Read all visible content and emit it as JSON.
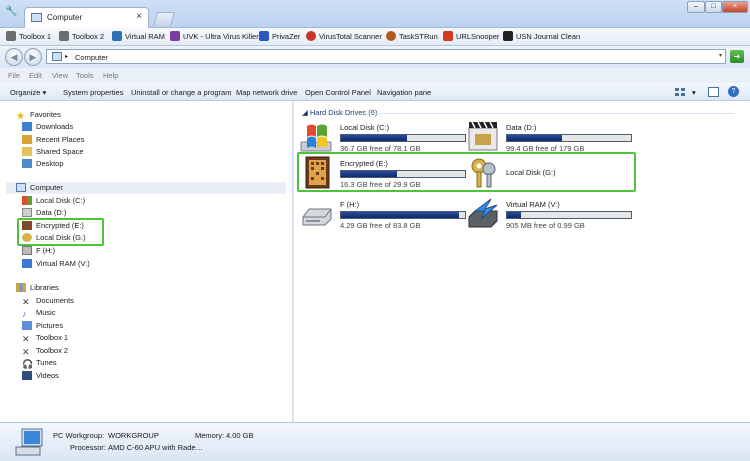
{
  "window": {
    "tab_title": "Computer",
    "tab_close": "×",
    "min_button": "–",
    "max_button": "□",
    "close_button": "×"
  },
  "bookmarks": [
    {
      "label": "Toolbox 1",
      "icon": "tools-icon",
      "color": "#6d6d6d"
    },
    {
      "label": "Toolbox 2",
      "icon": "tools-icon",
      "color": "#6d6d6d"
    },
    {
      "label": "Virtual RAM",
      "icon": "ram-icon",
      "color": "#2f6fb8"
    },
    {
      "label": "UVK - Ultra Virus Killer",
      "icon": "uvk-icon",
      "color": "#7a3ea3"
    },
    {
      "label": "PrivaZer",
      "icon": "privazer-icon",
      "color": "#2a56c6"
    },
    {
      "label": "VirusTotal Scanner",
      "icon": "virustotal-icon",
      "color": "#c8322b"
    },
    {
      "label": "TaskSTRun",
      "icon": "taskstrun-icon",
      "color": "#b35a1f"
    },
    {
      "label": "URLSnooper",
      "icon": "urlsnooper-icon",
      "color": "#d23b1c"
    },
    {
      "label": "USN Journal Clean",
      "icon": "usn-icon",
      "color": "#222222"
    }
  ],
  "address": {
    "path": "Computer",
    "separator": "▸",
    "dropdown": "▾",
    "go": "➜"
  },
  "menu": [
    "File",
    "Edit",
    "View",
    "Tools",
    "Help"
  ],
  "commands": {
    "organize": "Organize",
    "organize_arrow": "▾",
    "system_properties": "System properties",
    "uninstall": "Uninstall or change a program",
    "map_drive": "Map network drive",
    "control_panel": "Open Control Panel",
    "navigation_pane": "Navigation pane",
    "view_arrow": "▾",
    "help": "?"
  },
  "nav": {
    "favorites": {
      "label": "Favorites",
      "items": [
        "Downloads",
        "Recent Places",
        "Shared Space",
        "Desktop"
      ]
    },
    "computer": {
      "label": "Computer",
      "items": [
        "Local Disk (C:)",
        "Data (D:)",
        "Encrypted (E:)",
        "Local Disk (G:)",
        "F (H:)",
        "Virtual RAM (V:)"
      ]
    },
    "libraries": {
      "label": "Libraries",
      "items": [
        "Documents",
        "Music",
        "Pictures",
        "Toolbox 1",
        "Toolbox 2",
        "Tunes",
        "Videos"
      ]
    }
  },
  "content": {
    "group_header": "Hard Disk Drives (6)",
    "drives": [
      {
        "name": "Local Disk (C:)",
        "free": "36.7 GB free of 78.1 GB",
        "used_fraction": 0.53,
        "icon": "windows-drive-icon"
      },
      {
        "name": "Data (D:)",
        "free": "99.4 GB free of 179 GB",
        "used_fraction": 0.44,
        "icon": "media-drive-icon"
      },
      {
        "name": "Encrypted (E:)",
        "free": "16.3 GB free of 29.9 GB",
        "used_fraction": 0.45,
        "icon": "encrypted-drive-icon"
      },
      {
        "name": "Local Disk (G:)",
        "free": "",
        "used_fraction": null,
        "icon": "keys-drive-icon"
      },
      {
        "name": "F (H:)",
        "free": "4.29 GB free of 83.8 GB",
        "used_fraction": 0.95,
        "icon": "hdd-icon"
      },
      {
        "name": "Virtual RAM (V:)",
        "free": "905 MB free of 0.99 GB",
        "used_fraction": 0.11,
        "icon": "ramdisk-icon"
      }
    ]
  },
  "details": {
    "workgroup_label": "PC Workgroup:",
    "workgroup_value": "WORKGROUP",
    "memory_label": "Memory:",
    "memory_value": "4.00 GB",
    "processor_label": "Processor:",
    "processor_value": "AMD C-60 APU with Rade…"
  },
  "colors": {
    "highlight": "#4cc43a",
    "drive_bar": "#1a3a84"
  }
}
